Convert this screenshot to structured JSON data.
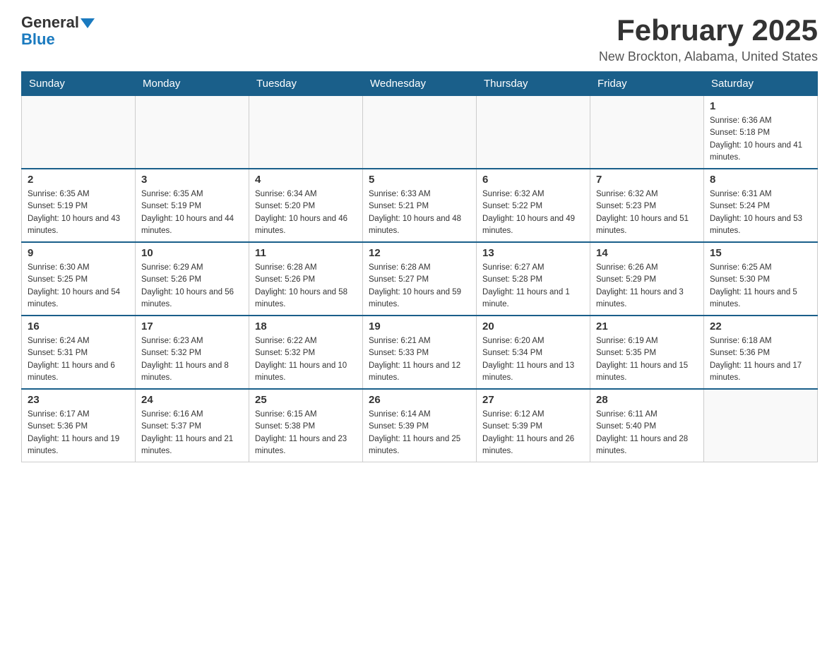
{
  "logo": {
    "general": "General",
    "blue": "Blue"
  },
  "title": "February 2025",
  "location": "New Brockton, Alabama, United States",
  "days_of_week": [
    "Sunday",
    "Monday",
    "Tuesday",
    "Wednesday",
    "Thursday",
    "Friday",
    "Saturday"
  ],
  "weeks": [
    [
      {
        "day": "",
        "sunrise": "",
        "sunset": "",
        "daylight": ""
      },
      {
        "day": "",
        "sunrise": "",
        "sunset": "",
        "daylight": ""
      },
      {
        "day": "",
        "sunrise": "",
        "sunset": "",
        "daylight": ""
      },
      {
        "day": "",
        "sunrise": "",
        "sunset": "",
        "daylight": ""
      },
      {
        "day": "",
        "sunrise": "",
        "sunset": "",
        "daylight": ""
      },
      {
        "day": "",
        "sunrise": "",
        "sunset": "",
        "daylight": ""
      },
      {
        "day": "1",
        "sunrise": "Sunrise: 6:36 AM",
        "sunset": "Sunset: 5:18 PM",
        "daylight": "Daylight: 10 hours and 41 minutes."
      }
    ],
    [
      {
        "day": "2",
        "sunrise": "Sunrise: 6:35 AM",
        "sunset": "Sunset: 5:19 PM",
        "daylight": "Daylight: 10 hours and 43 minutes."
      },
      {
        "day": "3",
        "sunrise": "Sunrise: 6:35 AM",
        "sunset": "Sunset: 5:19 PM",
        "daylight": "Daylight: 10 hours and 44 minutes."
      },
      {
        "day": "4",
        "sunrise": "Sunrise: 6:34 AM",
        "sunset": "Sunset: 5:20 PM",
        "daylight": "Daylight: 10 hours and 46 minutes."
      },
      {
        "day": "5",
        "sunrise": "Sunrise: 6:33 AM",
        "sunset": "Sunset: 5:21 PM",
        "daylight": "Daylight: 10 hours and 48 minutes."
      },
      {
        "day": "6",
        "sunrise": "Sunrise: 6:32 AM",
        "sunset": "Sunset: 5:22 PM",
        "daylight": "Daylight: 10 hours and 49 minutes."
      },
      {
        "day": "7",
        "sunrise": "Sunrise: 6:32 AM",
        "sunset": "Sunset: 5:23 PM",
        "daylight": "Daylight: 10 hours and 51 minutes."
      },
      {
        "day": "8",
        "sunrise": "Sunrise: 6:31 AM",
        "sunset": "Sunset: 5:24 PM",
        "daylight": "Daylight: 10 hours and 53 minutes."
      }
    ],
    [
      {
        "day": "9",
        "sunrise": "Sunrise: 6:30 AM",
        "sunset": "Sunset: 5:25 PM",
        "daylight": "Daylight: 10 hours and 54 minutes."
      },
      {
        "day": "10",
        "sunrise": "Sunrise: 6:29 AM",
        "sunset": "Sunset: 5:26 PM",
        "daylight": "Daylight: 10 hours and 56 minutes."
      },
      {
        "day": "11",
        "sunrise": "Sunrise: 6:28 AM",
        "sunset": "Sunset: 5:26 PM",
        "daylight": "Daylight: 10 hours and 58 minutes."
      },
      {
        "day": "12",
        "sunrise": "Sunrise: 6:28 AM",
        "sunset": "Sunset: 5:27 PM",
        "daylight": "Daylight: 10 hours and 59 minutes."
      },
      {
        "day": "13",
        "sunrise": "Sunrise: 6:27 AM",
        "sunset": "Sunset: 5:28 PM",
        "daylight": "Daylight: 11 hours and 1 minute."
      },
      {
        "day": "14",
        "sunrise": "Sunrise: 6:26 AM",
        "sunset": "Sunset: 5:29 PM",
        "daylight": "Daylight: 11 hours and 3 minutes."
      },
      {
        "day": "15",
        "sunrise": "Sunrise: 6:25 AM",
        "sunset": "Sunset: 5:30 PM",
        "daylight": "Daylight: 11 hours and 5 minutes."
      }
    ],
    [
      {
        "day": "16",
        "sunrise": "Sunrise: 6:24 AM",
        "sunset": "Sunset: 5:31 PM",
        "daylight": "Daylight: 11 hours and 6 minutes."
      },
      {
        "day": "17",
        "sunrise": "Sunrise: 6:23 AM",
        "sunset": "Sunset: 5:32 PM",
        "daylight": "Daylight: 11 hours and 8 minutes."
      },
      {
        "day": "18",
        "sunrise": "Sunrise: 6:22 AM",
        "sunset": "Sunset: 5:32 PM",
        "daylight": "Daylight: 11 hours and 10 minutes."
      },
      {
        "day": "19",
        "sunrise": "Sunrise: 6:21 AM",
        "sunset": "Sunset: 5:33 PM",
        "daylight": "Daylight: 11 hours and 12 minutes."
      },
      {
        "day": "20",
        "sunrise": "Sunrise: 6:20 AM",
        "sunset": "Sunset: 5:34 PM",
        "daylight": "Daylight: 11 hours and 13 minutes."
      },
      {
        "day": "21",
        "sunrise": "Sunrise: 6:19 AM",
        "sunset": "Sunset: 5:35 PM",
        "daylight": "Daylight: 11 hours and 15 minutes."
      },
      {
        "day": "22",
        "sunrise": "Sunrise: 6:18 AM",
        "sunset": "Sunset: 5:36 PM",
        "daylight": "Daylight: 11 hours and 17 minutes."
      }
    ],
    [
      {
        "day": "23",
        "sunrise": "Sunrise: 6:17 AM",
        "sunset": "Sunset: 5:36 PM",
        "daylight": "Daylight: 11 hours and 19 minutes."
      },
      {
        "day": "24",
        "sunrise": "Sunrise: 6:16 AM",
        "sunset": "Sunset: 5:37 PM",
        "daylight": "Daylight: 11 hours and 21 minutes."
      },
      {
        "day": "25",
        "sunrise": "Sunrise: 6:15 AM",
        "sunset": "Sunset: 5:38 PM",
        "daylight": "Daylight: 11 hours and 23 minutes."
      },
      {
        "day": "26",
        "sunrise": "Sunrise: 6:14 AM",
        "sunset": "Sunset: 5:39 PM",
        "daylight": "Daylight: 11 hours and 25 minutes."
      },
      {
        "day": "27",
        "sunrise": "Sunrise: 6:12 AM",
        "sunset": "Sunset: 5:39 PM",
        "daylight": "Daylight: 11 hours and 26 minutes."
      },
      {
        "day": "28",
        "sunrise": "Sunrise: 6:11 AM",
        "sunset": "Sunset: 5:40 PM",
        "daylight": "Daylight: 11 hours and 28 minutes."
      },
      {
        "day": "",
        "sunrise": "",
        "sunset": "",
        "daylight": ""
      }
    ]
  ]
}
